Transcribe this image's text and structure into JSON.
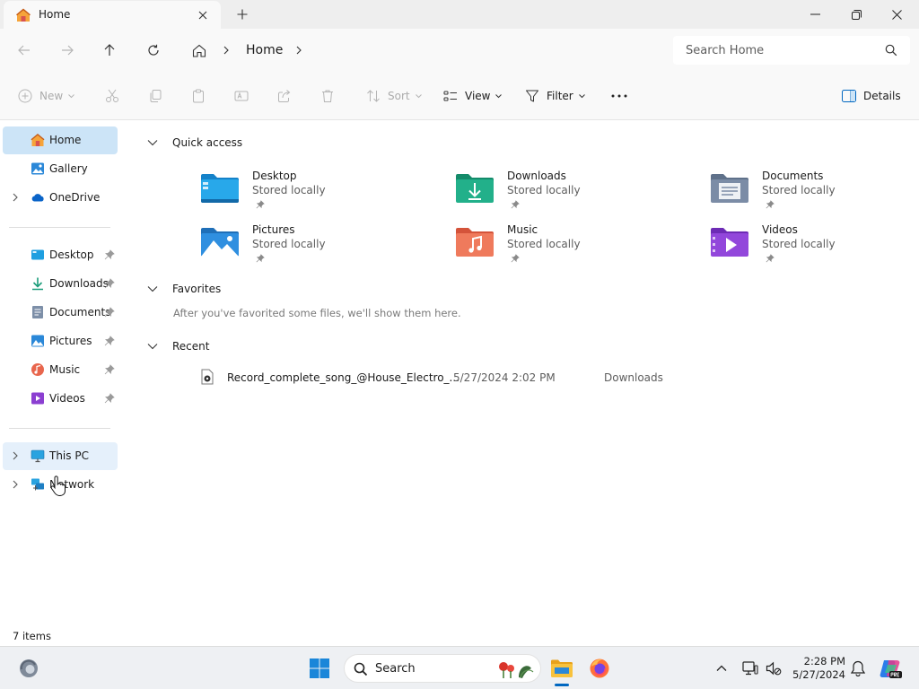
{
  "window": {
    "tab_title": "Home"
  },
  "nav": {
    "breadcrumb_current": "Home",
    "search_placeholder": "Search Home"
  },
  "command_bar": {
    "new_label": "New",
    "sort_label": "Sort",
    "view_label": "View",
    "filter_label": "Filter",
    "details_label": "Details"
  },
  "sidebar": {
    "top_items": [
      {
        "label": "Home",
        "icon": "home-icon",
        "selected": true
      },
      {
        "label": "Gallery",
        "icon": "gallery-icon"
      },
      {
        "label": "OneDrive",
        "icon": "onedrive-icon",
        "expandable": true
      }
    ],
    "pinned_items": [
      {
        "label": "Desktop",
        "icon": "desktop-folder-icon"
      },
      {
        "label": "Downloads",
        "icon": "downloads-folder-icon"
      },
      {
        "label": "Documents",
        "icon": "documents-folder-icon"
      },
      {
        "label": "Pictures",
        "icon": "pictures-folder-icon"
      },
      {
        "label": "Music",
        "icon": "music-folder-icon"
      },
      {
        "label": "Videos",
        "icon": "videos-folder-icon"
      }
    ],
    "bottom_items": [
      {
        "label": "This PC",
        "icon": "this-pc-icon",
        "expandable": true
      },
      {
        "label": "Network",
        "icon": "network-icon",
        "expandable": true
      }
    ]
  },
  "main": {
    "quick_access": {
      "title": "Quick access",
      "items": [
        {
          "name": "Desktop",
          "sub": "Stored locally"
        },
        {
          "name": "Downloads",
          "sub": "Stored locally"
        },
        {
          "name": "Documents",
          "sub": "Stored locally"
        },
        {
          "name": "Pictures",
          "sub": "Stored locally"
        },
        {
          "name": "Music",
          "sub": "Stored locally"
        },
        {
          "name": "Videos",
          "sub": "Stored locally"
        }
      ]
    },
    "favorites": {
      "title": "Favorites",
      "empty_text": "After you've favorited some files, we'll show them here."
    },
    "recent": {
      "title": "Recent",
      "items": [
        {
          "name": "Record_complete_song_@House_Electro_...",
          "date": "5/27/2024 2:02 PM",
          "location": "Downloads"
        }
      ]
    }
  },
  "status": {
    "item_count": "7 items"
  },
  "taskbar": {
    "search_label": "Search",
    "time": "2:28 PM",
    "date": "5/27/2024"
  },
  "colors": {
    "accent": "#0067c0",
    "selected_bg": "#cce4f7",
    "chrome_bg": "#f9f9f9"
  }
}
